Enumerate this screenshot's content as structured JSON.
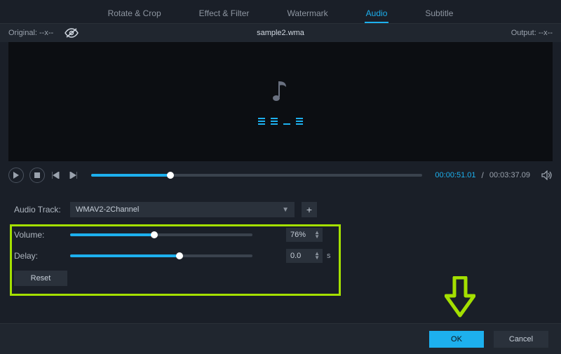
{
  "tabs": [
    "Rotate & Crop",
    "Effect & Filter",
    "Watermark",
    "Audio",
    "Subtitle"
  ],
  "active_tab_index": 3,
  "infobar": {
    "original_label": "Original: --x--",
    "output_label": "Output: --x--",
    "filename": "sample2.wma"
  },
  "playback": {
    "current_time": "00:00:51.01",
    "duration": "00:03:37.09",
    "progress_pct": 24
  },
  "audio_track": {
    "label": "Audio Track:",
    "selected": "WMAV2-2Channel"
  },
  "volume": {
    "label": "Volume:",
    "value_text": "76%",
    "slider_pct": 46
  },
  "delay": {
    "label": "Delay:",
    "value_text": "0.0",
    "unit": "s",
    "slider_pct": 60
  },
  "buttons": {
    "reset": "Reset",
    "ok": "OK",
    "cancel": "Cancel"
  },
  "icons": {
    "eye_off": "eye-off-icon",
    "music_note": "music-note-icon",
    "play": "play-icon",
    "stop": "stop-icon",
    "prev": "prev-icon",
    "next": "next-icon",
    "speaker": "speaker-icon",
    "plus": "plus-icon",
    "caret_down": "caret-down-icon"
  }
}
